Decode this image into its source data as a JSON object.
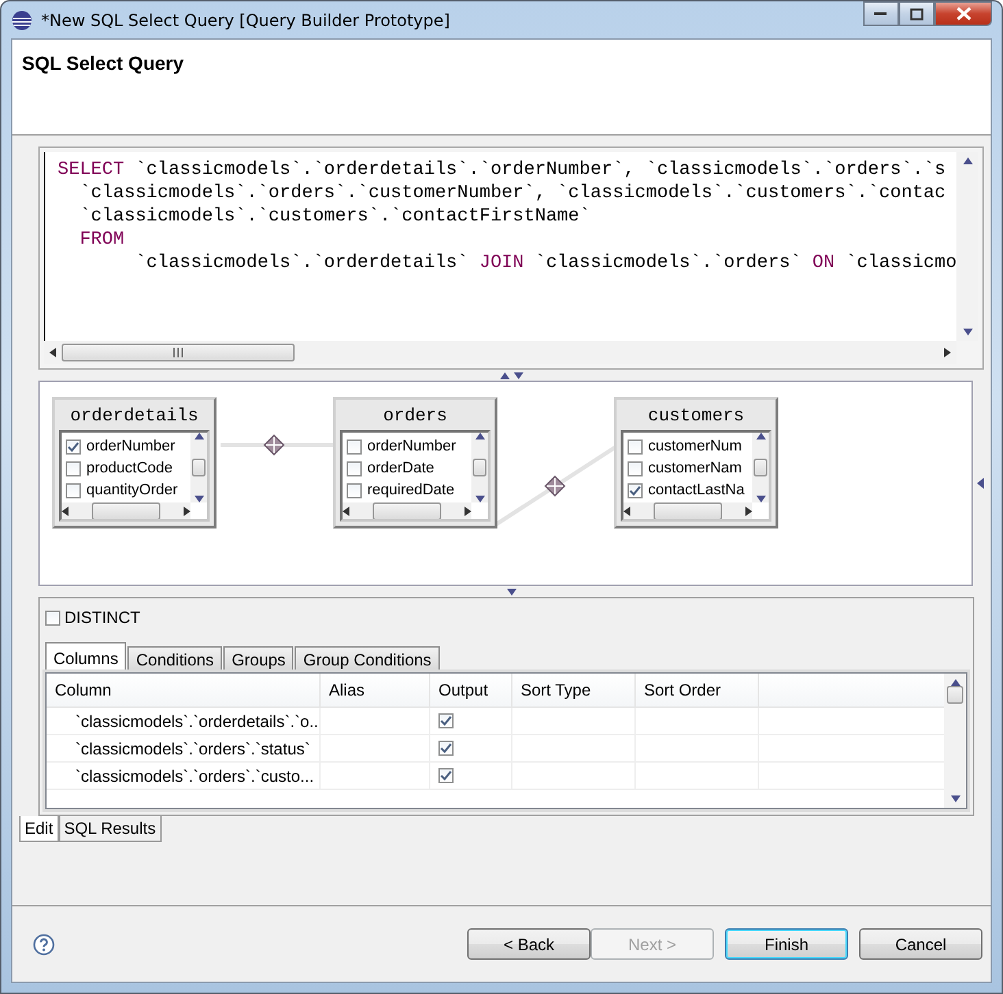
{
  "window": {
    "title": "*New SQL Select Query [Query Builder Prototype]"
  },
  "header": {
    "title": "SQL Select Query"
  },
  "sql_editor": {
    "lines": [
      {
        "segments": [
          {
            "kind": "keyword",
            "text": "SELECT"
          },
          {
            "kind": "plain",
            "text": " `classicmodels`.`orderdetails`.`orderNumber`, `classicmodels`.`orders`.`s"
          }
        ]
      },
      {
        "segments": [
          {
            "kind": "plain",
            "text": "  `classicmodels`.`orders`.`customerNumber`, `classicmodels`.`customers`.`contac"
          }
        ]
      },
      {
        "segments": [
          {
            "kind": "plain",
            "text": "  `classicmodels`.`customers`.`contactFirstName`"
          }
        ]
      },
      {
        "segments": [
          {
            "kind": "keyword",
            "text": "  FROM"
          }
        ]
      },
      {
        "segments": [
          {
            "kind": "plain",
            "text": "       `classicmodels`.`orderdetails` "
          },
          {
            "kind": "keyword",
            "text": "JOIN"
          },
          {
            "kind": "plain",
            "text": " `classicmodels`.`orders` "
          },
          {
            "kind": "keyword",
            "text": "ON"
          },
          {
            "kind": "plain",
            "text": " `classicmo"
          }
        ]
      }
    ]
  },
  "diagram": {
    "tables": [
      {
        "name": "orderdetails",
        "columns": [
          {
            "label": "orderNumber",
            "checked": true
          },
          {
            "label": "productCode",
            "checked": false
          },
          {
            "label": "quantityOrder",
            "checked": false
          }
        ]
      },
      {
        "name": "orders",
        "columns": [
          {
            "label": "orderNumber",
            "checked": false
          },
          {
            "label": "orderDate",
            "checked": false
          },
          {
            "label": "requiredDate",
            "checked": false
          }
        ]
      },
      {
        "name": "customers",
        "columns": [
          {
            "label": "customerNum",
            "checked": false
          },
          {
            "label": "customerNam",
            "checked": false
          },
          {
            "label": "contactLastNa",
            "checked": true
          }
        ]
      }
    ]
  },
  "distinct": {
    "label": "DISTINCT",
    "checked": false
  },
  "tabs": [
    {
      "label": "Columns",
      "selected": true
    },
    {
      "label": "Conditions",
      "selected": false
    },
    {
      "label": "Groups",
      "selected": false
    },
    {
      "label": "Group Conditions",
      "selected": false
    }
  ],
  "columns_table": {
    "columns": [
      "Column",
      "Alias",
      "Output",
      "Sort Type",
      "Sort Order"
    ],
    "rows": [
      {
        "column": "`classicmodels`.`orderdetails`.`o...",
        "output": true
      },
      {
        "column": "`classicmodels`.`orders`.`status`",
        "output": true
      },
      {
        "column": "`classicmodels`.`orders`.`custo...",
        "output": true
      }
    ]
  },
  "page_tabs": [
    {
      "label": "Edit",
      "selected": true
    },
    {
      "label": "SQL Results",
      "selected": false
    }
  ],
  "buttons": [
    {
      "label": "< Back",
      "disabled": false,
      "default": false
    },
    {
      "label": "Next >",
      "disabled": true,
      "default": false
    },
    {
      "label": "Finish",
      "disabled": false,
      "default": true
    },
    {
      "label": "Cancel",
      "disabled": false,
      "default": false
    }
  ]
}
